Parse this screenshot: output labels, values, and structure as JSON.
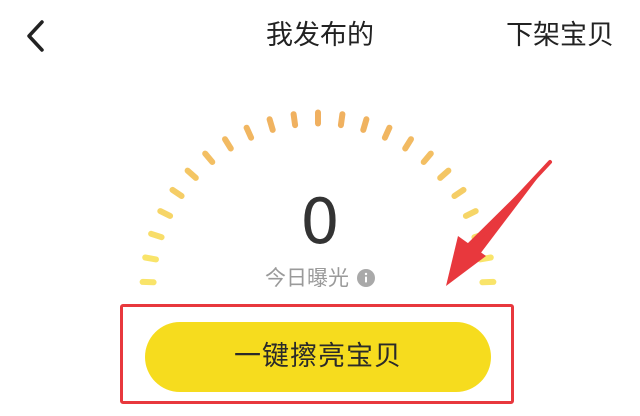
{
  "nav": {
    "title": "我发布的",
    "action": "下架宝贝"
  },
  "stats": {
    "count": "0",
    "label": "今日曝光"
  },
  "primary_button": {
    "label": "一键擦亮宝贝"
  },
  "icons": {
    "back": "chevron-left-icon",
    "info": "info-icon",
    "arrow": "pointer-arrow-icon"
  },
  "colors": {
    "accent_yellow": "#f6dc1e",
    "annotation_red": "#e8383d",
    "gauge_orange": "#f0b060",
    "gauge_yellow": "#f9e46a",
    "text_dark": "#222222",
    "text_gray": "#9a9a9a"
  }
}
